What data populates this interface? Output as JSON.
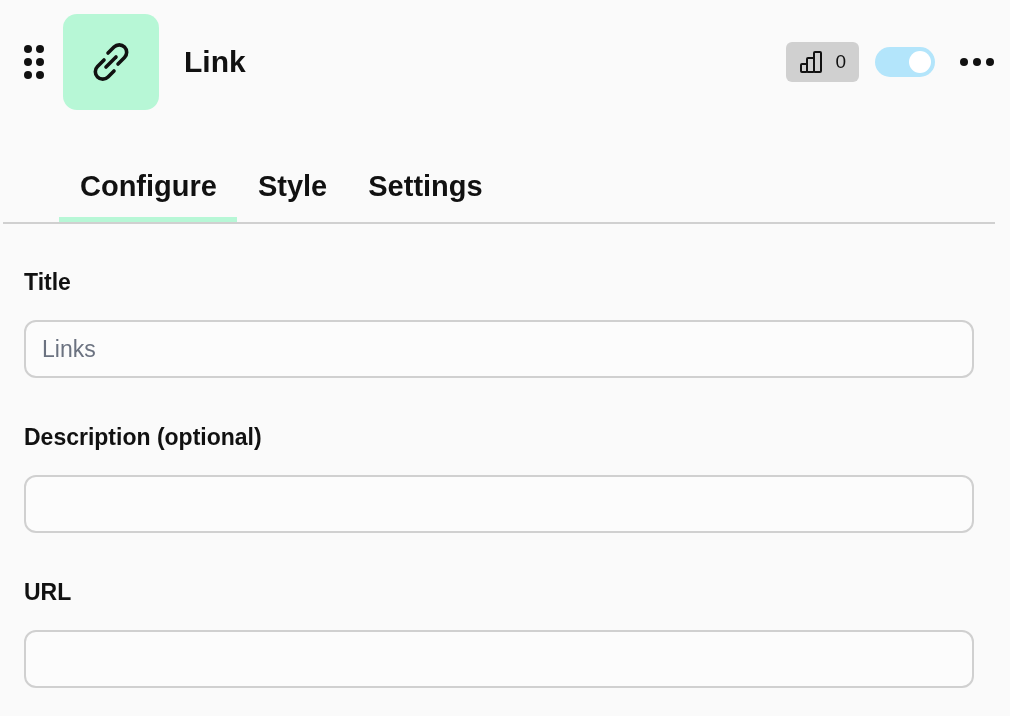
{
  "header": {
    "title": "Link",
    "badge": {
      "count": "0"
    },
    "toggle": {
      "on": true
    }
  },
  "tabs": [
    {
      "label": "Configure",
      "selected": true
    },
    {
      "label": "Style",
      "selected": false
    },
    {
      "label": "Settings",
      "selected": false
    }
  ],
  "fields": [
    {
      "label": "Title",
      "placeholder": "Links"
    },
    {
      "label": "Description (optional)"
    },
    {
      "label": "URL"
    }
  ]
}
